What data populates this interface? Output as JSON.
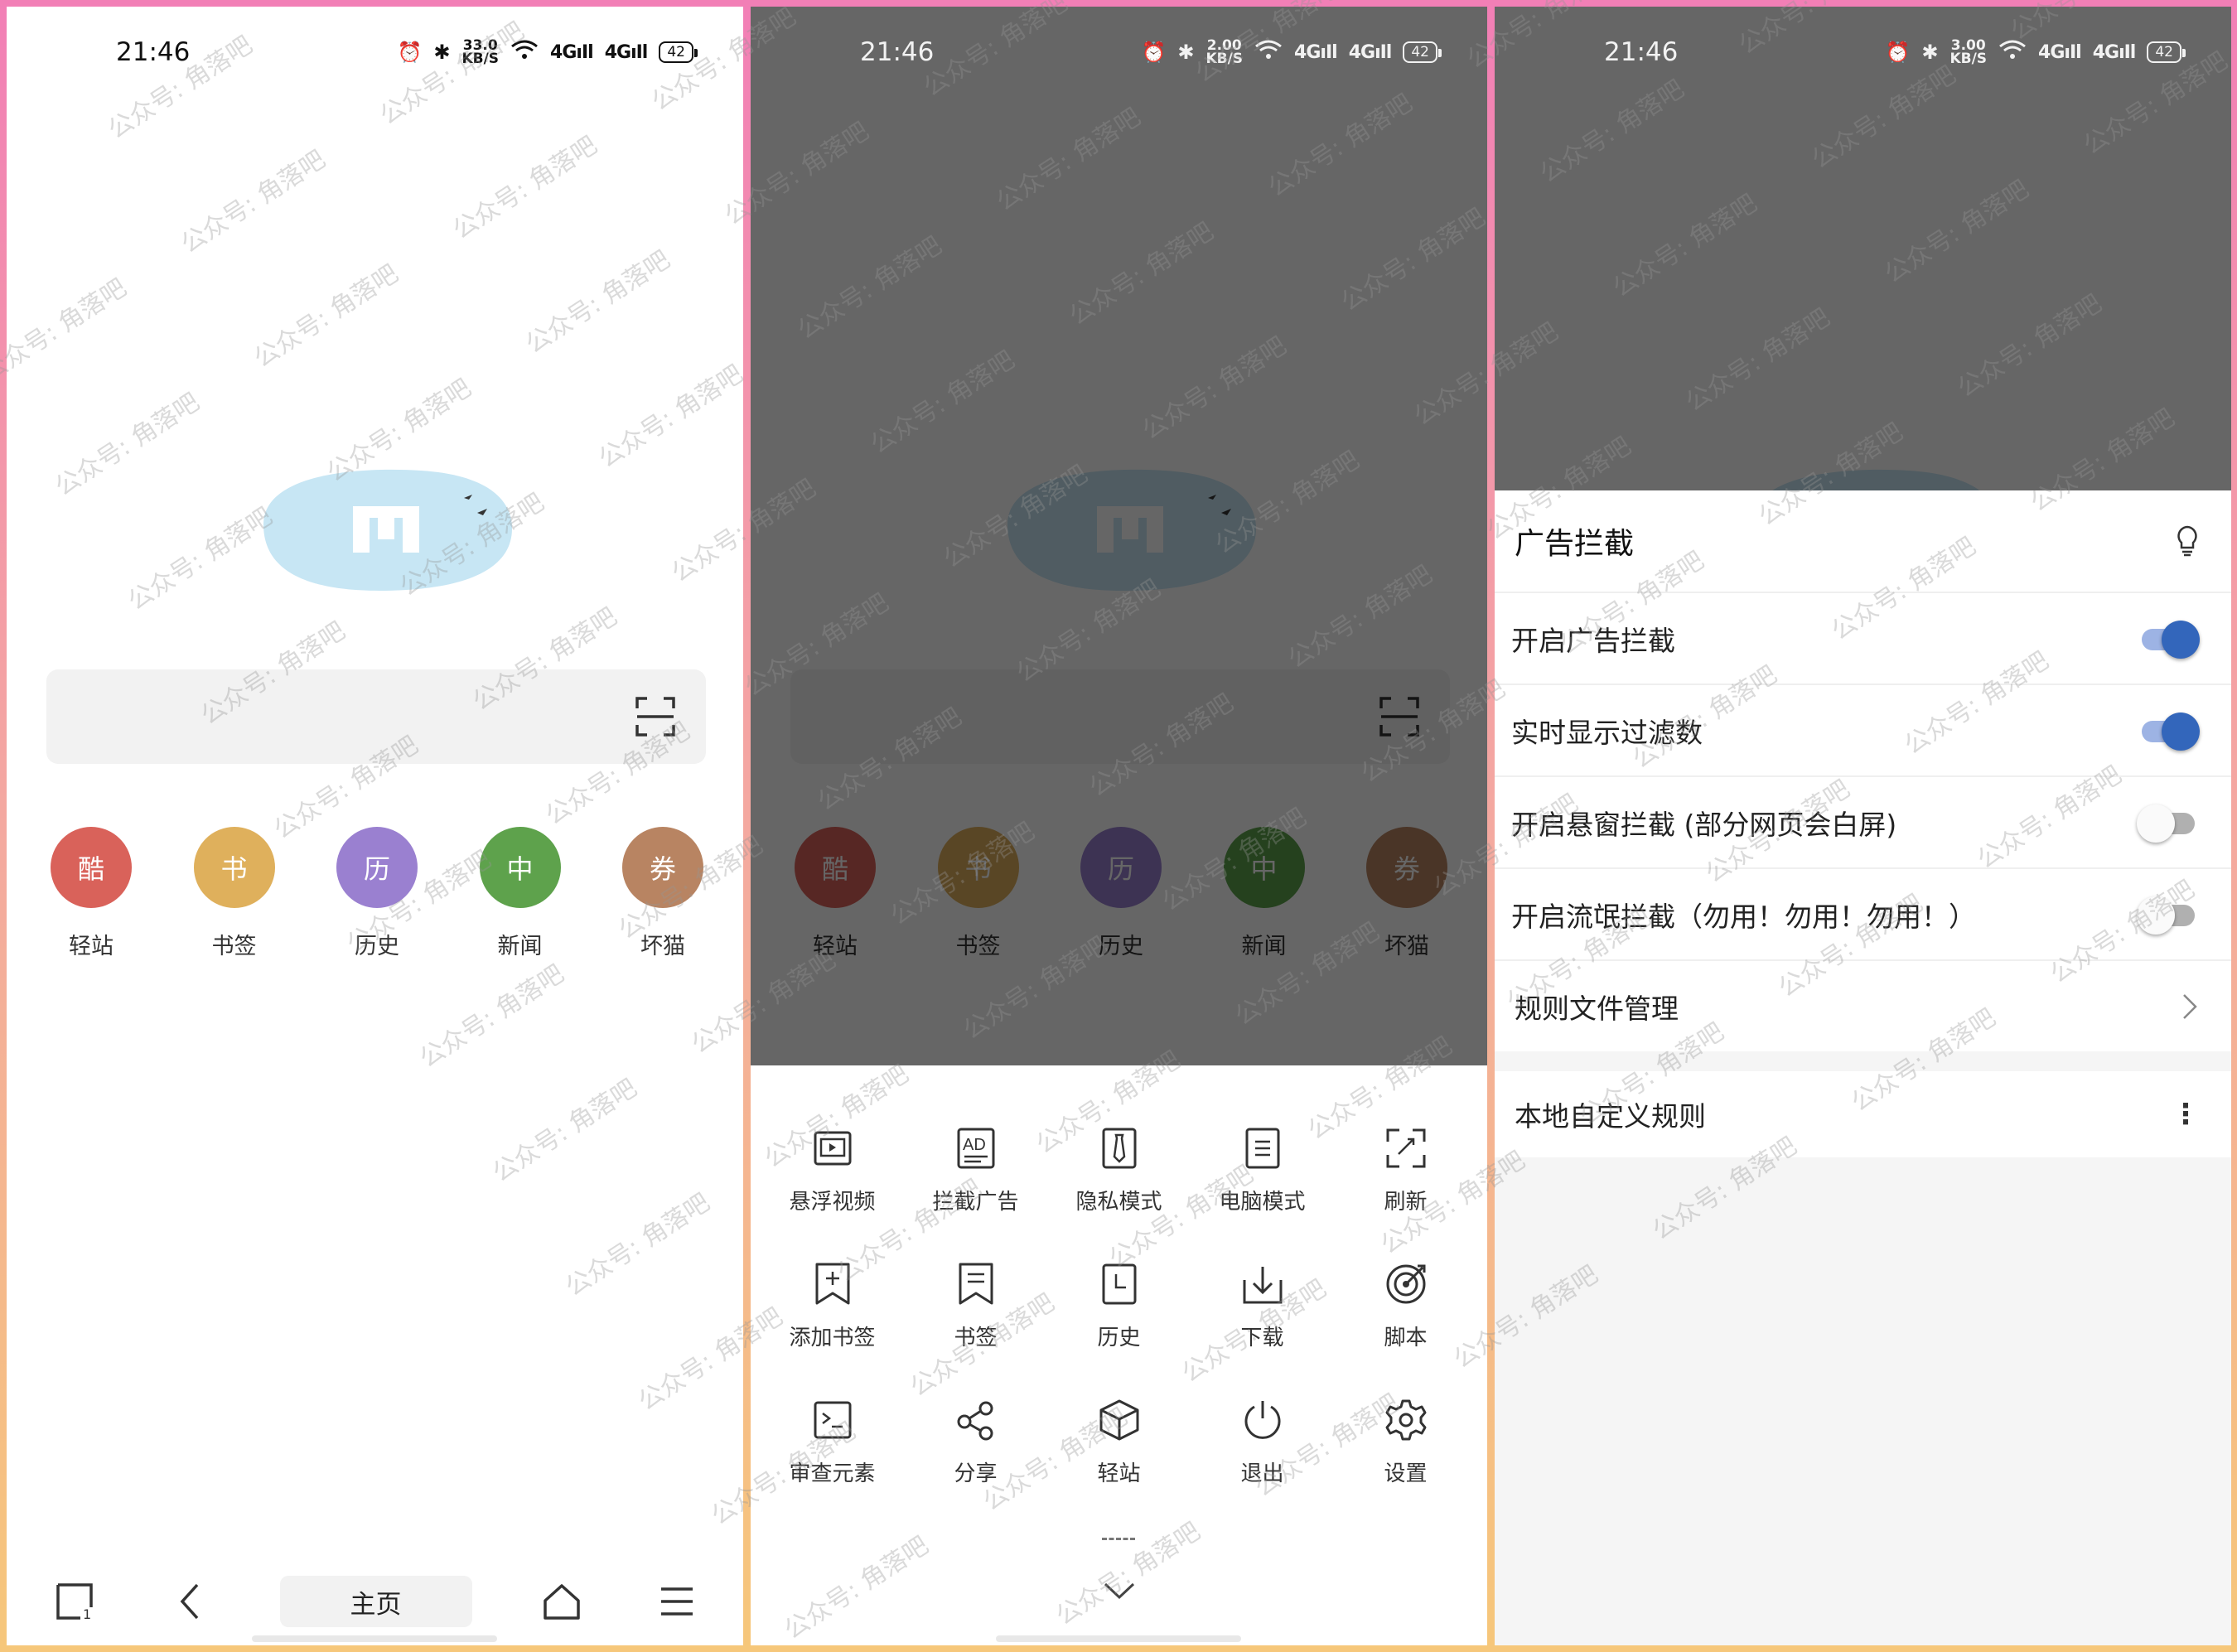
{
  "status_bar": {
    "time": "21:46",
    "panel1_speed_value": "33.0",
    "panel2_speed_value": "2.00",
    "panel3_speed_value": "3.00",
    "speed_unit": "KB/S",
    "network_label": "4G",
    "battery": "42"
  },
  "home": {
    "quick_links": [
      {
        "glyph": "酷",
        "label": "轻站",
        "color": "#d9625a"
      },
      {
        "glyph": "书",
        "label": "书签",
        "color": "#dfb05c"
      },
      {
        "glyph": "历",
        "label": "历史",
        "color": "#9a80d0"
      },
      {
        "glyph": "中",
        "label": "新闻",
        "color": "#5ea24c"
      },
      {
        "glyph": "券",
        "label": "坏猫",
        "color": "#b88462"
      }
    ],
    "home_label": "主页"
  },
  "menu": {
    "items": [
      {
        "label": "悬浮视频",
        "icon": "floating-video-icon"
      },
      {
        "label": "拦截广告",
        "icon": "ad-block-icon",
        "icon_text": "AD"
      },
      {
        "label": "隐私模式",
        "icon": "privacy-mode-icon"
      },
      {
        "label": "电脑模式",
        "icon": "desktop-mode-icon"
      },
      {
        "label": "刷新",
        "icon": "refresh-icon"
      },
      {
        "label": "添加书签",
        "icon": "add-bookmark-icon"
      },
      {
        "label": "书签",
        "icon": "bookmarks-icon"
      },
      {
        "label": "历史",
        "icon": "history-icon"
      },
      {
        "label": "下载",
        "icon": "download-icon"
      },
      {
        "label": "脚本",
        "icon": "script-icon"
      },
      {
        "label": "审查元素",
        "icon": "inspect-element-icon"
      },
      {
        "label": "分享",
        "icon": "share-icon"
      },
      {
        "label": "轻站",
        "icon": "light-site-icon"
      },
      {
        "label": "退出",
        "icon": "exit-icon"
      },
      {
        "label": "设置",
        "icon": "settings-icon"
      }
    ]
  },
  "adblock": {
    "title": "广告拦截",
    "rows": [
      {
        "label": "开启广告拦截",
        "on": true
      },
      {
        "label": "实时显示过滤数",
        "on": true
      },
      {
        "label": "开启悬窗拦截 (部分网页会白屏)",
        "on": false
      },
      {
        "label": "开启流氓拦截（勿用！勿用！勿用！）",
        "on": false
      }
    ],
    "rule_files": "规则文件管理",
    "custom_rules": "本地自定义规则"
  },
  "watermark_text": "公众号: 角落吧",
  "colors": {
    "toggle_on": "#3366bb",
    "toggle_on_track": "#9db3e4",
    "logo_blue": "#c7e6f4"
  }
}
